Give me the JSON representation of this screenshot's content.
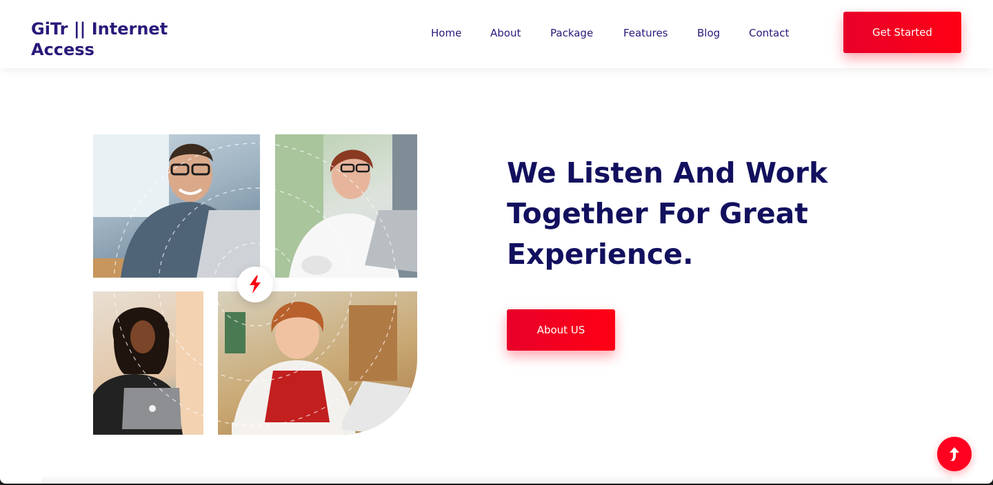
{
  "header": {
    "brand": "GiTr || Internet Access",
    "nav": [
      {
        "label": "Home"
      },
      {
        "label": "About"
      },
      {
        "label": "Package"
      },
      {
        "label": "Features"
      },
      {
        "label": "Blog"
      },
      {
        "label": "Contact"
      }
    ],
    "cta_label": "Get Started"
  },
  "hero": {
    "headline": "We Listen And Work Together For Great Experience.",
    "button_label": "About US",
    "center_icon": "lightning-bolt-icon",
    "photos": [
      "smiling-man-laptop-photo",
      "woman-glasses-laptop-photo",
      "woman-macbook-photo",
      "child-tablet-photo"
    ]
  },
  "scroll_top_icon": "arrow-up-icon",
  "colors": {
    "brand_navy": "#281a7a",
    "headline_navy": "#12105e",
    "accent_red": "#ff0014"
  }
}
